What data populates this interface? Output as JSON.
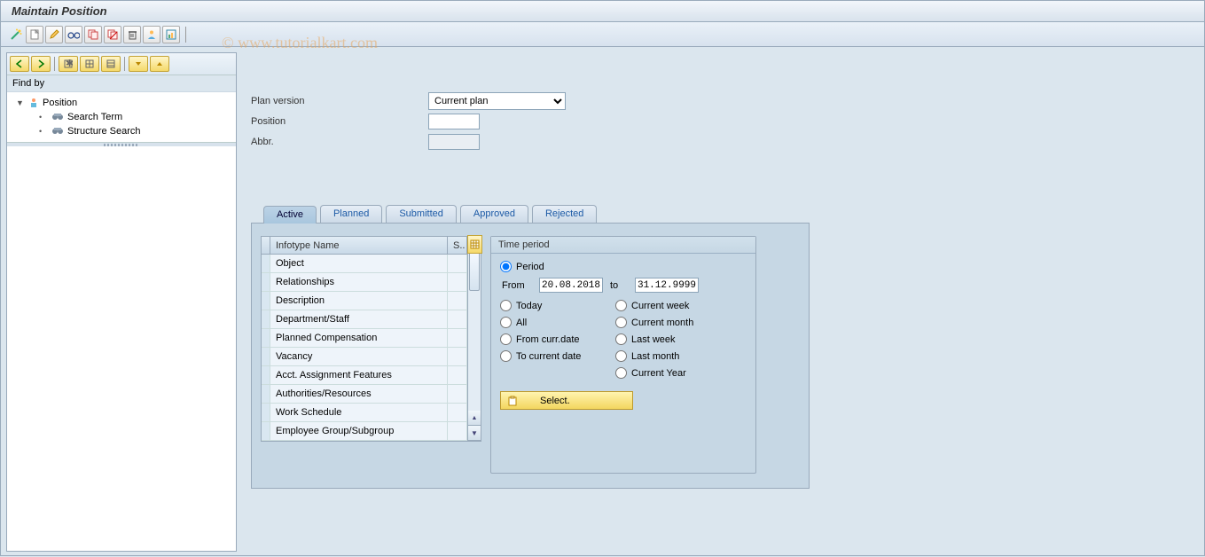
{
  "title": "Maintain Position",
  "watermark": "©  www.tutorialkart.com",
  "toolbar_icons": [
    "wand",
    "new",
    "edit",
    "glasses",
    "copy",
    "delimit",
    "delete",
    "person",
    "overview"
  ],
  "left": {
    "find_by": "Find by",
    "tree": {
      "root": "Position",
      "children": [
        "Search Term",
        "Structure Search"
      ]
    }
  },
  "form": {
    "plan_version_label": "Plan version",
    "plan_version_value": "Current plan",
    "position_label": "Position",
    "position_value": "",
    "abbr_label": "Abbr.",
    "abbr_value": ""
  },
  "tabs": [
    "Active",
    "Planned",
    "Submitted",
    "Approved",
    "Rejected"
  ],
  "active_tab": "Active",
  "infotype": {
    "header_name": "Infotype Name",
    "header_s": "S..",
    "rows": [
      "Object",
      "Relationships",
      "Description",
      "Department/Staff",
      "Planned Compensation",
      "Vacancy",
      "Acct. Assignment Features",
      "Authorities/Resources",
      "Work Schedule",
      "Employee Group/Subgroup"
    ]
  },
  "time_period": {
    "title": "Time period",
    "period": "Period",
    "from_label": "From",
    "from_value": "20.08.2018",
    "to_label": "to",
    "to_value": "31.12.9999",
    "today": "Today",
    "all": "All",
    "from_curr": "From curr.date",
    "to_curr": "To current date",
    "cur_week": "Current week",
    "cur_month": "Current month",
    "last_week": "Last week",
    "last_month": "Last month",
    "cur_year": "Current Year",
    "select_btn": "Select."
  }
}
